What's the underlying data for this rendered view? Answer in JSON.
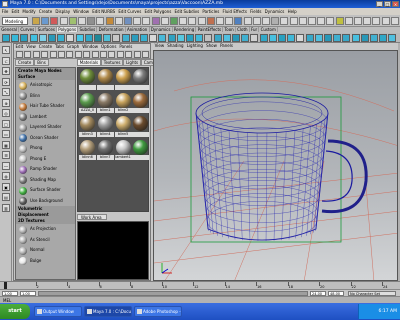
{
  "title_text": "Maya 7.0 : C:\\Documents and Settings\\dejo\\Documents\\maya\\projects\\azza\\Vaccoon\\AZZA.mb",
  "menu": [
    "File",
    "Edit",
    "Modify",
    "Create",
    "Display",
    "Window",
    "Edit NURBS",
    "Edit Curves",
    "Edit Polygons",
    "Edit Subdivs",
    "Particles",
    "Fluid Effects",
    "Fields",
    "Dynamics",
    "Help"
  ],
  "status_mode": "Modeling",
  "shelf_tabs": [
    "General",
    "Curves",
    "Surfaces",
    "Polygons",
    "Subdivs",
    "Deformation",
    "Animation",
    "Dynamics",
    "Rendering",
    "PaintEffects",
    "Toon",
    "Cloth",
    "Fur",
    "Custom"
  ],
  "shelf_active_index": 3,
  "hypershade_menu": [
    "Edit",
    "View",
    "Create",
    "Tabs",
    "Graph",
    "Window",
    "Options",
    "Panels"
  ],
  "create_tabs": [
    "Create",
    "Bins"
  ],
  "create_list": [
    {
      "type": "group",
      "label": "Create Maya Nodes"
    },
    {
      "type": "group",
      "label": "Surface"
    },
    {
      "type": "item",
      "label": "Anisotropic",
      "color": "#d8b25a"
    },
    {
      "type": "item",
      "label": "Blinn",
      "color": "#8e8e8e"
    },
    {
      "type": "item",
      "label": "Hair Tube Shader",
      "color": "#c47a3a"
    },
    {
      "type": "item",
      "label": "Lambert",
      "color": "#7a7a7a"
    },
    {
      "type": "item",
      "label": "Layered Shader",
      "color": "#a0a0a0"
    },
    {
      "type": "item",
      "label": "Ocean Shader",
      "color": "#3d6fa8"
    },
    {
      "type": "item",
      "label": "Phong",
      "color": "#b8b8b8"
    },
    {
      "type": "item",
      "label": "Phong E",
      "color": "#c8c8c8"
    },
    {
      "type": "item",
      "label": "Ramp Shader",
      "color": "#9c6bb5"
    },
    {
      "type": "item",
      "label": "Shading Map",
      "color": "#777777"
    },
    {
      "type": "item",
      "label": "Surface Shader",
      "color": "#3fae3f"
    },
    {
      "type": "item",
      "label": "Use Background",
      "color": "#5a5a5a"
    },
    {
      "type": "group",
      "label": "Volumetric"
    },
    {
      "type": "group",
      "label": "Displacement"
    },
    {
      "type": "group",
      "label": "2D Textures"
    },
    {
      "type": "item",
      "label": "As Projection",
      "color": "#b0b0b0"
    },
    {
      "type": "item",
      "label": "As Stencil",
      "color": "#b0b0b0"
    },
    {
      "type": "item",
      "label": "Normal",
      "color": "#b0b0b0"
    },
    {
      "type": "item",
      "label": "Bulge",
      "color": "#e8e8e8"
    }
  ],
  "mat_tabs": [
    "Materials",
    "Textures",
    "Lights",
    "Cameras"
  ],
  "mat_tab_active": 0,
  "materials": [
    {
      "label": "",
      "color": "#6f8f3a"
    },
    {
      "label": "",
      "color": "#b28b4a"
    },
    {
      "label": "",
      "color": "#cfa250"
    },
    {
      "label": "",
      "color": "#7d7d7d"
    },
    {
      "label": "AZZA_II",
      "color": "#5b9c4e"
    },
    {
      "label": "blinn1",
      "color": "#8a7a66"
    },
    {
      "label": "blinn2",
      "color": "#c8a35c"
    },
    {
      "label": "",
      "color": "#9c6b3c"
    },
    {
      "label": "blinn3",
      "color": "#a38a5e"
    },
    {
      "label": "blinn4",
      "color": "#9e9e9e"
    },
    {
      "label": "blinn5",
      "color": "#d0b070"
    },
    {
      "label": "",
      "color": "#6a4a2c"
    },
    {
      "label": "blinn6",
      "color": "#b5a07c"
    },
    {
      "label": "blinn7",
      "color": "#727272"
    },
    {
      "label": "lambert1",
      "color": "#c7c7c7"
    },
    {
      "label": "",
      "color": "#3f9b3f"
    }
  ],
  "work_tab": "Work Area",
  "vp_menu": [
    "View",
    "Shading",
    "Lighting",
    "Show",
    "Panels"
  ],
  "time_ticks": [
    "1",
    "2",
    "4",
    "6",
    "8",
    "10",
    "12",
    "14",
    "16",
    "18",
    "20",
    "22",
    "24"
  ],
  "range": {
    "start": "1.00",
    "in": "1.00",
    "out": "24.00",
    "end": "48.00",
    "char": "No Character Set"
  },
  "cmdline_label": "MEL",
  "taskbar": {
    "start": "start",
    "tasks": [
      "Output Window",
      "Maya 7.0 : C:\\Docum",
      "Adobe Photoshop - [..."
    ],
    "active": 1,
    "clock": "6:17 AM"
  }
}
